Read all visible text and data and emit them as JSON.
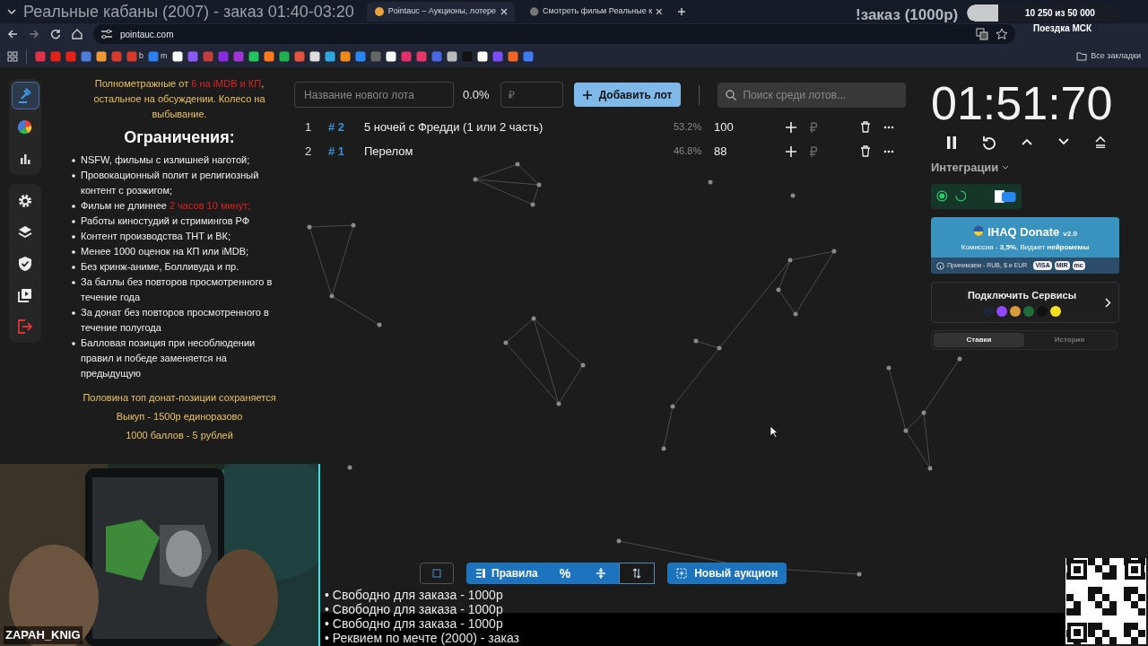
{
  "stream_overlay": {
    "title": "Реальные кабаны (2007) - заказ 01:40-03:20",
    "order_label": "!заказ (1000р)",
    "goal": {
      "level": 0.205,
      "reading": "10 250  из 50 000",
      "name": "Поездка МСК"
    },
    "streamer": "ZAPAH_KNIG",
    "queue": [
      "• Свободно для заказа - 1000р",
      "• Свободно для заказа - 1000р",
      "• Свободно для заказа - 1000р",
      "• Реквием по мечте (2000) - заказ"
    ]
  },
  "browser": {
    "tabs": [
      {
        "title": "Pointauc – Аукционы, лотере",
        "selected": true
      },
      {
        "title": "Смотреть фильм Реальные к",
        "selected": false
      }
    ],
    "url": "pointauc.com",
    "bookmark_labels": [
      "b",
      "m"
    ],
    "all_bookmarks": "Все закладки"
  },
  "sidebar": {
    "items": [
      {
        "selected": true
      },
      {
        "selected": false
      },
      {
        "selected": false
      },
      {
        "selected": false
      },
      {
        "selected": false
      },
      {
        "selected": false
      },
      {
        "selected": false
      },
      {
        "selected": false
      }
    ]
  },
  "rules": {
    "intro": [
      {
        "text": "Полнометражные от ",
        "highlight": false
      },
      {
        "text": "6 на iMDB и КП",
        "highlight": true
      },
      {
        "text": ", остальное на обсуждении. Колесо на выбывание.",
        "highlight": false
      }
    ],
    "heading": "Ограничения:",
    "items": [
      [
        {
          "text": "NSFW, фильмы с излишней наготой;",
          "highlight": false
        }
      ],
      [
        {
          "text": "Провокационный полит и религиозный контент с розжигом;",
          "highlight": false
        }
      ],
      [
        {
          "text": "Фильм не длиннее ",
          "highlight": false
        },
        {
          "text": "2 часов 10 минут;",
          "highlight": true
        }
      ],
      [
        {
          "text": "Работы киностудий и стримингов РФ",
          "highlight": false
        }
      ],
      [
        {
          "text": "Контент производства ТНТ и ВК;",
          "highlight": false
        }
      ],
      [
        {
          "text": "Менее 1000 оценок на КП или iMDB;",
          "highlight": false
        }
      ],
      [
        {
          "text": "Без кринж-аниме, Болливуда и пр.",
          "highlight": false
        }
      ],
      [
        {
          "text": "За баллы без повторов просмотренного в течение года",
          "highlight": false
        }
      ],
      [
        {
          "text": "За донат без повторов просмотренного в течение полугода",
          "highlight": false
        }
      ],
      [
        {
          "text": "Балловая позиция при несоблюдении правил и победе заменяется на предыдущую",
          "highlight": false
        }
      ]
    ],
    "notes": [
      "Половина топ донат-позиции сохраняется",
      "Выкуп - 1500р единоразово",
      "1000 баллов - 5 рублей"
    ]
  },
  "lot_form": {
    "name_placeholder": "Название нового лота",
    "percent": "0.0%",
    "amount_placeholder": "₽",
    "add_button": "Добавить лот",
    "search_placeholder": "Поиск среди лотов..."
  },
  "lots": [
    {
      "index": "1",
      "id": "# 2",
      "name": "5 ночей с Фредди (1 или 2 часть)",
      "share": "53.2%",
      "amount": "100"
    },
    {
      "index": "2",
      "id": "# 1",
      "name": "Перелом",
      "share": "46.8%",
      "amount": "88"
    }
  ],
  "timer": {
    "time": "01:51:70"
  },
  "integrations": {
    "title": "Интеграции",
    "toggles": [
      {
        "on": true
      },
      {
        "on": false
      }
    ]
  },
  "donate_card": {
    "name": "IHAQ Donate",
    "version": "v2.0",
    "terms": "Комиссия - **3,5%**, Виджет **нейромемы**",
    "accepts": "Принимаем - RUB, $ и EUR",
    "payment_badges": [
      "VISA",
      "MIR",
      "mc"
    ]
  },
  "services": {
    "title": "Подключить Сервисы"
  },
  "history_tabs": [
    {
      "label": "Ставки",
      "selected": true
    },
    {
      "label": "История",
      "selected": false
    }
  ],
  "toolbar": {
    "rules_button": "Правила",
    "percent_button": "%",
    "new_auction_button": "Новый аукцион"
  }
}
